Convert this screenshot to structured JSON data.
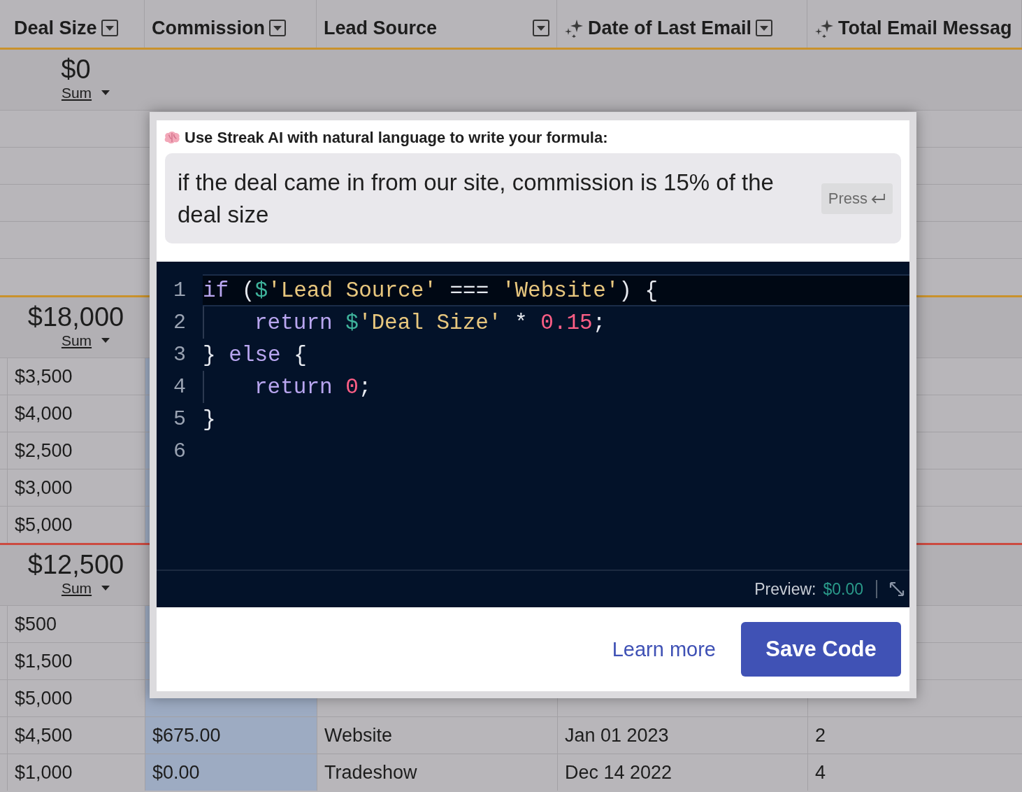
{
  "columns": [
    {
      "label": "Deal Size",
      "ai": false,
      "menu": true,
      "selected": false
    },
    {
      "label": "Commission",
      "ai": false,
      "menu": true,
      "selected": true
    },
    {
      "label": "Lead Source",
      "ai": false,
      "menu": true,
      "selected": false
    },
    {
      "label": "Date of Last Email",
      "ai": true,
      "menu": true,
      "selected": false
    },
    {
      "label": "Total Email Messag",
      "ai": true,
      "menu": false,
      "selected": false
    }
  ],
  "groups": [
    {
      "color": "#c9922c",
      "total": "$0",
      "aggregate": "Sum"
    },
    {
      "color": "#c9922c",
      "total": "$18,000",
      "aggregate": "Sum",
      "rows": [
        {
          "cells": [
            "$3,500"
          ]
        },
        {
          "cells": [
            "$4,000"
          ]
        },
        {
          "cells": [
            "$2,500"
          ]
        },
        {
          "cells": [
            "$3,000"
          ]
        },
        {
          "cells": [
            "$5,000"
          ]
        }
      ]
    },
    {
      "color": "#cc4a40",
      "total": "$12,500",
      "aggregate": "Sum",
      "rows": [
        {
          "cells": [
            "$500"
          ]
        },
        {
          "cells": [
            "$1,500"
          ]
        },
        {
          "cells": [
            "$5,000"
          ]
        },
        {
          "cells": [
            "$4,500",
            "$675.00",
            "Website",
            "Jan 01 2023",
            "2"
          ]
        },
        {
          "cells": [
            "$1,000",
            "$0.00",
            "Tradeshow",
            "Dec 14 2022",
            "4"
          ]
        }
      ]
    }
  ],
  "formula_dialog": {
    "prompt_label": "Use Streak AI with natural language to write your formula:",
    "prompt": "if the deal came in from our site, commission is 15% of the deal size",
    "submit_hint": "Press",
    "code_lines": [
      {
        "number": "1",
        "active": true,
        "indent": false,
        "tokens": [
          {
            "text": "if",
            "kind": "keyword"
          },
          {
            "text": " (",
            "kind": "plain"
          },
          {
            "text": "$",
            "kind": "variable"
          },
          {
            "text": "'Lead Source'",
            "kind": "string"
          },
          {
            "text": " === ",
            "kind": "plain"
          },
          {
            "text": "'Website'",
            "kind": "string"
          },
          {
            "text": ") {",
            "kind": "plain"
          }
        ]
      },
      {
        "number": "2",
        "active": false,
        "indent": true,
        "tokens": [
          {
            "text": "return",
            "kind": "keyword"
          },
          {
            "text": " $",
            "kind": "variable"
          },
          {
            "text": "'Deal Size'",
            "kind": "string"
          },
          {
            "text": " * ",
            "kind": "plain"
          },
          {
            "text": "0.15",
            "kind": "number"
          },
          {
            "text": ";",
            "kind": "plain"
          }
        ]
      },
      {
        "number": "3",
        "active": false,
        "indent": false,
        "tokens": [
          {
            "text": "} ",
            "kind": "plain"
          },
          {
            "text": "else",
            "kind": "keyword"
          },
          {
            "text": " {",
            "kind": "plain"
          }
        ]
      },
      {
        "number": "4",
        "active": false,
        "indent": true,
        "tokens": [
          {
            "text": "return",
            "kind": "keyword"
          },
          {
            "text": " 0",
            "kind": "number"
          },
          {
            "text": ";",
            "kind": "plain"
          }
        ]
      },
      {
        "number": "5",
        "active": false,
        "indent": false,
        "tokens": [
          {
            "text": "}",
            "kind": "plain"
          }
        ]
      },
      {
        "number": "6",
        "active": false,
        "indent": false
      }
    ],
    "preview_label": "Preview:",
    "preview_value": "$0.00",
    "learn_more": "Learn more",
    "save": "Save Code"
  }
}
